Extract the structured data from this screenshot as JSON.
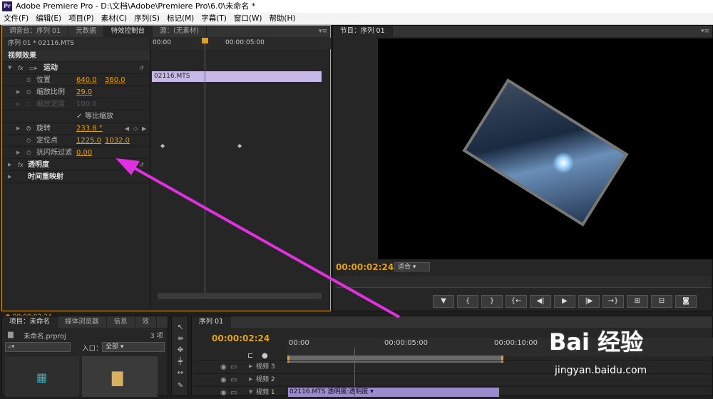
{
  "title": "Adobe Premiere Pro - D:\\文档\\Adobe\\Premiere Pro\\6.0\\未命名 *",
  "app_icon": "Pr",
  "menu": [
    "文件(F)",
    "编辑(E)",
    "项目(P)",
    "素材(C)",
    "序列(S)",
    "标记(M)",
    "字幕(T)",
    "窗口(W)",
    "帮助(H)"
  ],
  "ec": {
    "tabs": [
      "调音台：序列 01",
      "元数据",
      "特效控制台",
      "源：(无素材)"
    ],
    "seq": "序列 01 * 02116.MTS",
    "ruler": [
      "00:00",
      "00:00:05:00"
    ],
    "clip": "02116.MTS",
    "video_effects": "视频效果",
    "motion": "运动",
    "position": "位置",
    "pos_x": "640.0",
    "pos_y": "360.0",
    "scale": "缩放比例",
    "scale_val": "29.0",
    "scale_width": "缩放宽度",
    "scale_width_val": "100.0",
    "uniform": "等比缩放",
    "rotation": "旋转",
    "rotation_val": "233.8 °",
    "anchor": "定位点",
    "anchor_x": "1225.0",
    "anchor_y": "1032.0",
    "flicker": "抗闪烁过滤",
    "flicker_val": "0.00",
    "opacity": "透明度",
    "time_remap": "时间重映射",
    "time": "00:00:02:24"
  },
  "pm": {
    "tab": "节目：序列 01",
    "time": "00:00:02:24",
    "fit": "适合"
  },
  "proj": {
    "tabs": [
      "项目：未命名",
      "媒体浏览器",
      "信息",
      "效"
    ],
    "file": "未命名.prproj",
    "count": "3 项",
    "in_label": "入口：",
    "in_value": "全部"
  },
  "tl": {
    "tab": "序列 01",
    "time": "00:00:02:24",
    "ruler": [
      "00:00",
      "00:00:05:00",
      "00:00:10:00"
    ],
    "tracks": [
      "视频 3",
      "视频 2",
      "视频 1"
    ],
    "clip": "02116.MTS  透明度:透明度"
  },
  "watermark": "Bai 经验",
  "watermark_url": "jingyan.baidu.com"
}
